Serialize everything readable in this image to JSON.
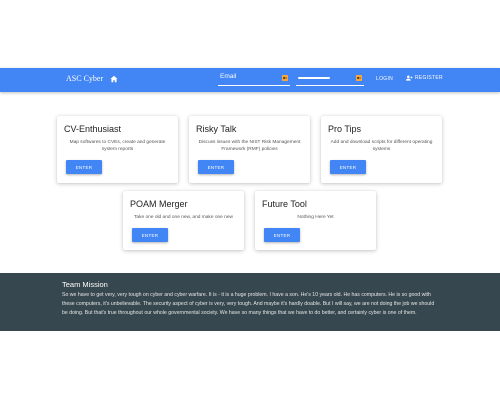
{
  "navbar": {
    "brand": "ASC Cyber",
    "home_icon": "home-icon",
    "email_placeholder": "Email",
    "login_label": "LOGIN",
    "register_label": "REGISTER",
    "accent_color": "#4285f4"
  },
  "cards": [
    {
      "title": "CV-Enthusiast",
      "description": "Map softwares to CVEs, create and generate system reports",
      "button": "ENTER"
    },
    {
      "title": "Risky Talk",
      "description": "Discuss issues with the NIST Risk Management Framework (RMF) policies",
      "button": "ENTER"
    },
    {
      "title": "Pro Tips",
      "description": "Add and download scripts for different operating systems",
      "button": "ENTER"
    },
    {
      "title": "POAM Merger",
      "description": "Take one old and one new, and make one new",
      "button": "ENTER"
    },
    {
      "title": "Future Tool",
      "description": "Nothing Here Yet",
      "button": "ENTER"
    }
  ],
  "footer": {
    "title": "Team Mission",
    "text": "So we have to get very, very tough on cyber and cyber warfare. It is - it is a huge problem. I have a son. He's 10 years old. He has computers. He is so good with these computers, it's unbelievable. The security aspect of cyber is very, very tough. And maybe it's hardly doable. But I will say, we are not doing the job we should be doing. But that's true throughout our whole governmental society. We have so many things that we have to do better, and certainly cyber is one of them.",
    "background_color": "#37474f"
  }
}
